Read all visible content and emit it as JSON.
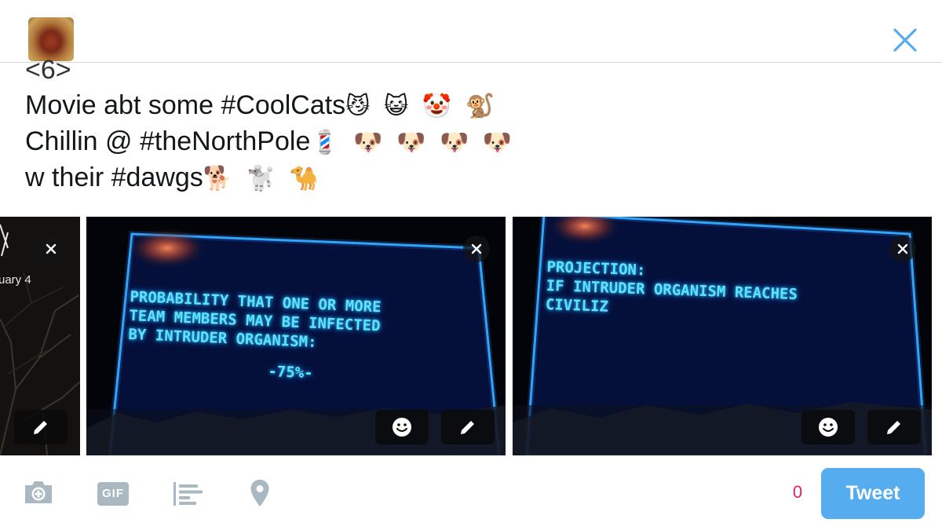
{
  "compose": {
    "lines": [
      {
        "text": "<6>",
        "emoji": ""
      },
      {
        "text": "Movie abt some #CoolCats",
        "emoji": "😼 😺 🤡 🐒"
      },
      {
        "text": "Chillin @ #theNorthPole",
        "emoji": "💈 🐶 🐶 🐶 🐶"
      },
      {
        "text": "w their #dawgs",
        "emoji": "🐕 🐩 🐪"
      }
    ]
  },
  "media": {
    "left_partial": {
      "date_fragment": "uary 4"
    },
    "middle": {
      "screen_lines": [
        "PROBABILITY THAT ONE OR MORE",
        "TEAM MEMBERS MAY BE INFECTED",
        "BY INTRUDER ORGANISM:"
      ],
      "screen_value": "-75%-"
    },
    "right": {
      "screen_lines": [
        "PROJECTION:",
        "IF INTRUDER ORGANISM REACHES",
        "CIVILIZ"
      ]
    }
  },
  "toolbar": {
    "icons": [
      "camera-icon",
      "gif-icon",
      "poll-icon",
      "location-pin-icon"
    ],
    "gif_label": "GIF",
    "char_count": "0",
    "tweet_label": "Tweet"
  },
  "colors": {
    "accent": "#55acee",
    "counter_warning": "#e0245e",
    "icon_gray": "#aab8c2",
    "screen_glow": "#5fe3f5"
  }
}
